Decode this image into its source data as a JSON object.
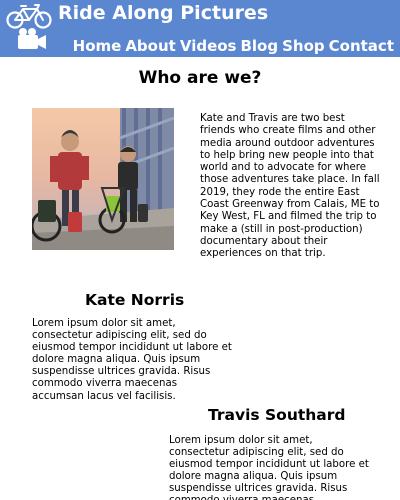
{
  "header": {
    "brand": "Ride Along Pictures",
    "logo_icon": "bicycle-camera-logo-icon",
    "nav": [
      "Home",
      "About",
      "Videos",
      "Blog",
      "Shop",
      "Contact"
    ],
    "color": "#5b86d0"
  },
  "who": {
    "title": "Who are we?",
    "body": "Kate and Travis are two best friends who create films and other media around outdoor adventures to help bring new people into that world and to advocate for where those adventures take place. In fall 2019, they rode the entire East Coast Greenway from Calais, ME to Key West, FL and filmed the trip to make a (still in post-production) documentary about their experiences on that trip."
  },
  "kate": {
    "name": "Kate Norris",
    "bio": "Lorem ipsum dolor sit amet, consectetur adipiscing elit, sed do eiusmod tempor incididunt ut labore et dolore magna aliqua. Quis ipsum suspendisse ultrices gravida. Risus commodo viverra maecenas accumsan lacus vel facilisis."
  },
  "travis": {
    "name": "Travis Southard",
    "bio": "Lorem ipsum dolor sit amet, consectetur adipiscing elit, sed do eiusmod tempor incididunt ut labore et dolore magna aliqua. Quis ipsum suspendisse ultrices gravida. Risus commodo viverra maecenas accumsan lacus vel facilisis."
  }
}
